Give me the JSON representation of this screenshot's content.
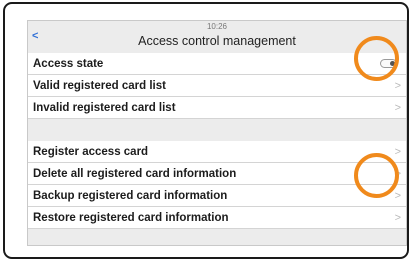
{
  "status_bar": {
    "time": "10:26"
  },
  "header": {
    "back_glyph": "<",
    "title": "Access control management"
  },
  "items": [
    {
      "label": "Access state",
      "control": "toggle"
    },
    {
      "label": "Valid registered card list",
      "control": "chevron"
    },
    {
      "label": "Invalid registered card list",
      "control": "chevron"
    },
    {
      "label": "Register access card",
      "control": "chevron"
    },
    {
      "label": "Delete all registered card information",
      "control": "chevron"
    },
    {
      "label": "Backup registered card information",
      "control": "chevron"
    },
    {
      "label": "Restore registered card information",
      "control": "chevron"
    }
  ],
  "chevron_glyph": ">",
  "colors": {
    "highlight_ring": "#f08a1c",
    "back_arrow": "#2f6fd6"
  }
}
